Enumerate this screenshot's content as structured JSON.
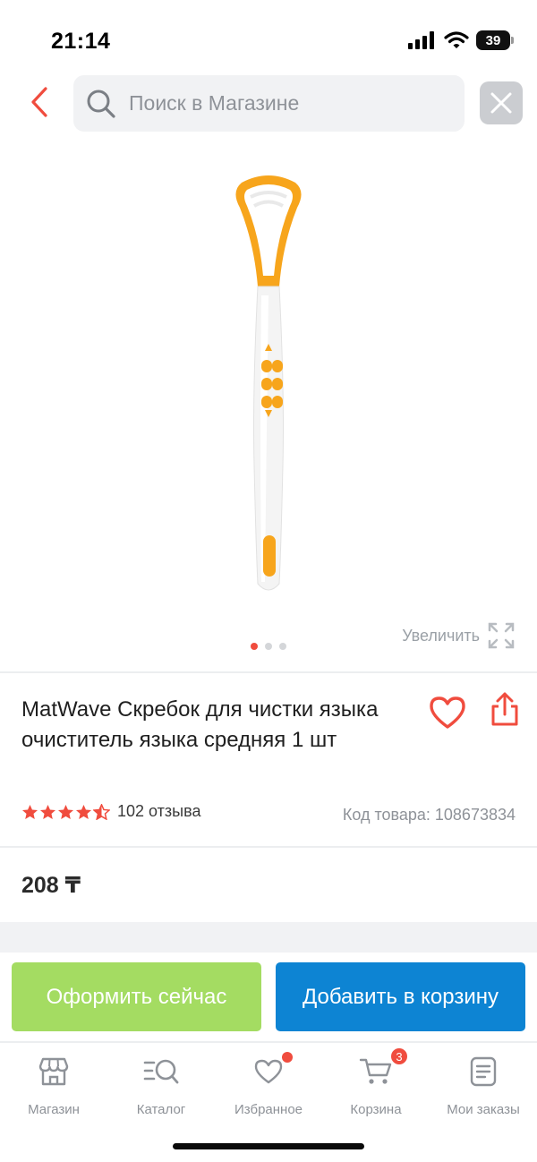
{
  "status_bar": {
    "time": "21:14",
    "battery": "39"
  },
  "header": {
    "search_placeholder": "Поиск в Магазине"
  },
  "gallery": {
    "zoom_label": "Увеличить",
    "image_count": 3,
    "active_image": 1
  },
  "product": {
    "title": "MatWave Скребок для чистки языка очиститель языка средняя 1 шт",
    "rating": 4.5,
    "reviews_label": "102 отзыва",
    "sku_label": "Код товара: 108673834",
    "price": "208 ₸"
  },
  "actions": {
    "checkout_label": "Оформить сейчас",
    "add_to_cart_label": "Добавить в корзину"
  },
  "bottom_nav": {
    "items": [
      {
        "label": "Магазин",
        "icon": "store-icon"
      },
      {
        "label": "Каталог",
        "icon": "catalog-search-icon"
      },
      {
        "label": "Избранное",
        "icon": "heart-icon"
      },
      {
        "label": "Корзина",
        "icon": "cart-icon"
      },
      {
        "label": "Мои заказы",
        "icon": "orders-icon"
      }
    ],
    "cart_count": "3"
  },
  "colors": {
    "accent_red": "#f04c3e",
    "checkout_green": "#a4dc62",
    "cart_blue": "#0d84d3",
    "product_orange": "#f7a51c"
  }
}
